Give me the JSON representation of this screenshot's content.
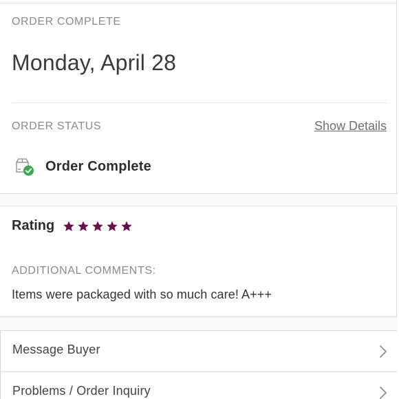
{
  "order": {
    "section_label": "ORDER COMPLETE",
    "date": "Monday, April 28"
  },
  "status": {
    "section_label": "ORDER STATUS",
    "show_details_label": "Show Details",
    "status_text": "Order Complete",
    "icon": "package-check-icon"
  },
  "rating": {
    "label": "Rating",
    "stars": 5,
    "max_stars": 5,
    "star_color": "#6b0f4a"
  },
  "comments": {
    "section_label": "ADDITIONAL COMMENTS:",
    "text": "Items were packaged with so much care! A+++"
  },
  "actions": [
    {
      "label": "Message Buyer",
      "icon": "chevron-right-icon"
    },
    {
      "label": "Problems / Order Inquiry",
      "icon": "chevron-right-icon"
    }
  ],
  "colors": {
    "accent_star": "#6b0f4a",
    "success_green": "#3aa853",
    "muted_text": "#8a8a8a"
  }
}
